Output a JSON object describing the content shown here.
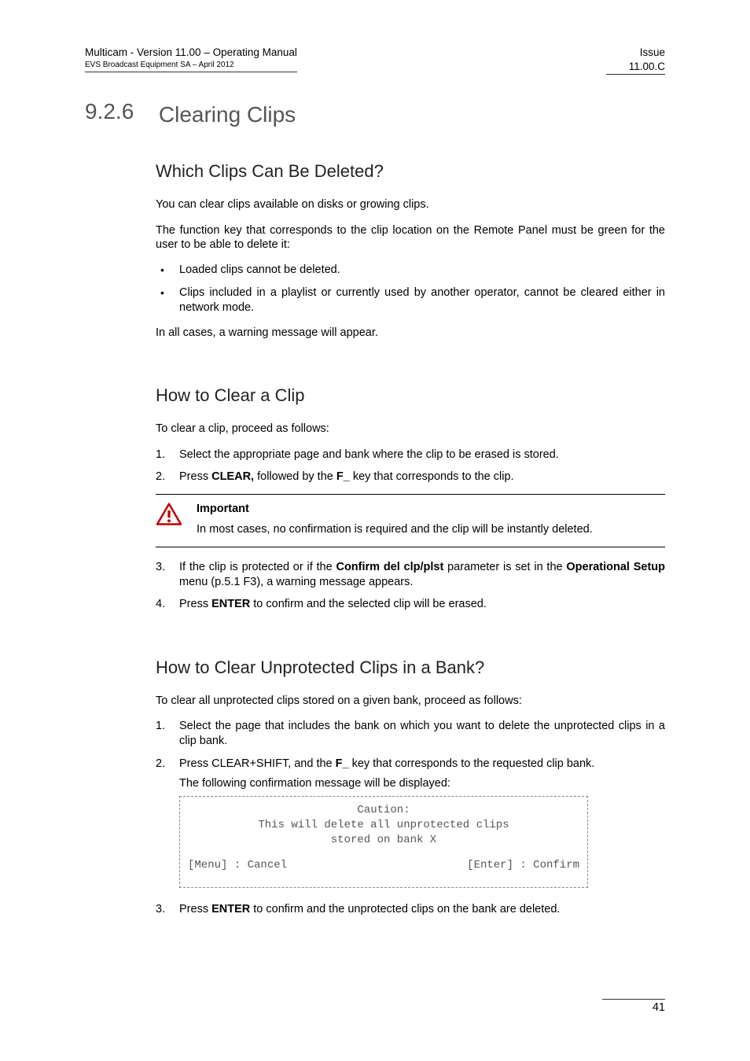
{
  "header": {
    "left_title": "Multicam - Version 11.00 – Operating Manual",
    "left_sub": "EVS Broadcast Equipment SA – April 2012",
    "right_top": "Issue",
    "right_bottom": "11.00.C"
  },
  "section": {
    "number": "9.2.6",
    "title": "Clearing Clips"
  },
  "h2_1": "Which Clips Can Be Deleted?",
  "p1": "You can clear clips available on disks or growing clips.",
  "p2": "The function key that corresponds to the clip location on the Remote Panel must be green for the user to be able to delete it:",
  "bullets": {
    "b1": "Loaded clips cannot be deleted.",
    "b2": "Clips included in a playlist or currently used by another operator, cannot be cleared either in network mode."
  },
  "p3": "In all cases, a warning message will appear.",
  "h2_2": "How to Clear a Clip",
  "p4": "To clear a clip, proceed as follows:",
  "steps_a": {
    "s1": "Select the appropriate page and bank where the clip to be erased is stored.",
    "s2_pre": "Press ",
    "s2_b1": "CLEAR,",
    "s2_mid": " followed by the ",
    "s2_b2": "F_",
    "s2_post": " key that corresponds to the clip."
  },
  "important": {
    "title": "Important",
    "text": "In most cases, no confirmation is required and the clip will be instantly deleted."
  },
  "steps_a2": {
    "s3_pre": "If the clip is protected or if the ",
    "s3_b1": "Confirm del clp/plst",
    "s3_mid": " parameter is set in the ",
    "s3_b2": "Operational Setup",
    "s3_post": " menu (p.5.1 F3), a warning message appears.",
    "s4_pre": "Press ",
    "s4_b1": "ENTER",
    "s4_post": " to confirm and the selected clip will be erased."
  },
  "h2_3": "How to Clear Unprotected Clips in a Bank?",
  "p5": "To clear all unprotected clips stored on a given bank, proceed as follows:",
  "steps_b": {
    "s1": "Select the page that includes the bank on which you want to delete the unprotected clips in a clip bank.",
    "s2_pre": "Press CLEAR+SHIFT, and the ",
    "s2_b1": "F_",
    "s2_post": " key that corresponds to the requested clip bank.",
    "s2_sub": "The following confirmation message will be displayed:"
  },
  "caution": {
    "line1": "Caution:",
    "line2": "This will delete all unprotected clips",
    "line3": "stored on bank X",
    "cancel": "[Menu] : Cancel",
    "confirm": "[Enter] : Confirm"
  },
  "steps_b2": {
    "s3_pre": "Press ",
    "s3_b1": "ENTER",
    "s3_post": " to confirm and the unprotected clips on the bank are deleted."
  },
  "page_number": "41"
}
